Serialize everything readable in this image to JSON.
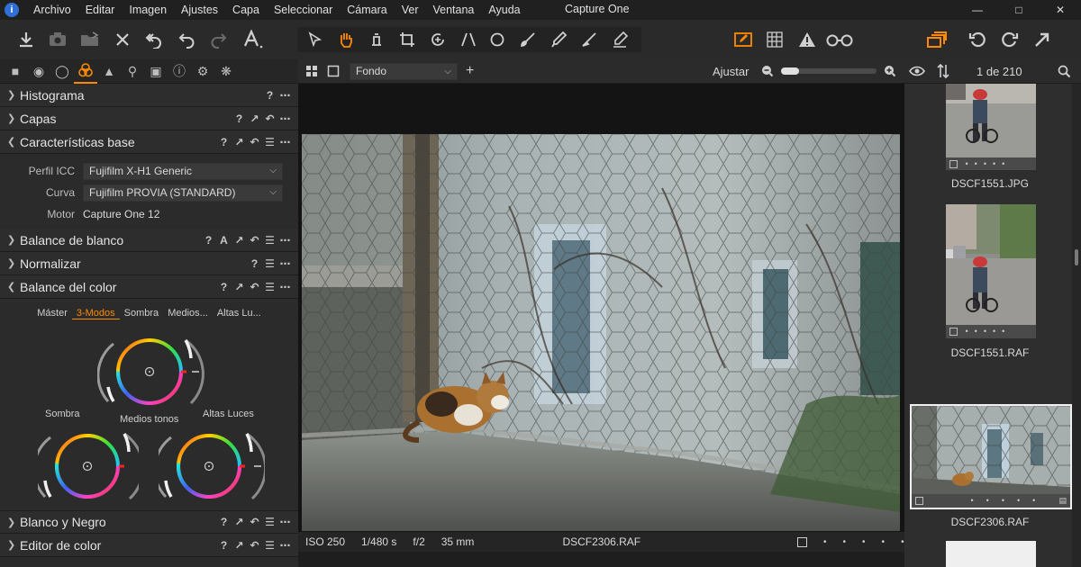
{
  "menu": [
    "Archivo",
    "Editar",
    "Imagen",
    "Ajustes",
    "Capa",
    "Seleccionar",
    "Cámara",
    "Ver",
    "Ventana",
    "Ayuda"
  ],
  "window_title": "Capture One",
  "colors": {
    "accent": "#ff8a00",
    "panel": "#2b2b2b",
    "header": "#2d2d2d",
    "viewer": "#141414"
  },
  "left_panel": {
    "tools": [
      {
        "label": "Histograma"
      },
      {
        "label": "Capas"
      },
      {
        "label": "Características base"
      },
      {
        "label": "Balance de blanco"
      },
      {
        "label": "Normalizar"
      },
      {
        "label": "Balance del color"
      },
      {
        "label": "Blanco y Negro"
      },
      {
        "label": "Editor de color"
      }
    ],
    "base": {
      "icc_label": "Perfil ICC",
      "icc_value": "Fujifilm X-H1 Generic",
      "curve_label": "Curva",
      "curve_value": "Fujifilm PROVIA (STANDARD)",
      "engine_label": "Motor",
      "engine_value": "Capture One 12"
    },
    "color_balance": {
      "tabs": [
        "Máster",
        "3-Modos",
        "Sombra",
        "Medios...",
        "Altas Lu..."
      ],
      "active_tab": 1,
      "shadow": "Sombra",
      "mid": "Medios tonos",
      "high": "Altas Luces"
    }
  },
  "viewer": {
    "layer": "Fondo",
    "fit": "Ajustar",
    "status": {
      "iso": "ISO 250",
      "shutter": "1/480 s",
      "aperture": "f/2",
      "focal": "35 mm",
      "filename": "DSCF2306.RAF"
    }
  },
  "browser": {
    "counter": "1 de 210",
    "items": [
      {
        "name": "DSCF1551.JPG"
      },
      {
        "name": "DSCF1551.RAF"
      },
      {
        "name": "DSCF2306.RAF",
        "selected": true
      }
    ]
  }
}
